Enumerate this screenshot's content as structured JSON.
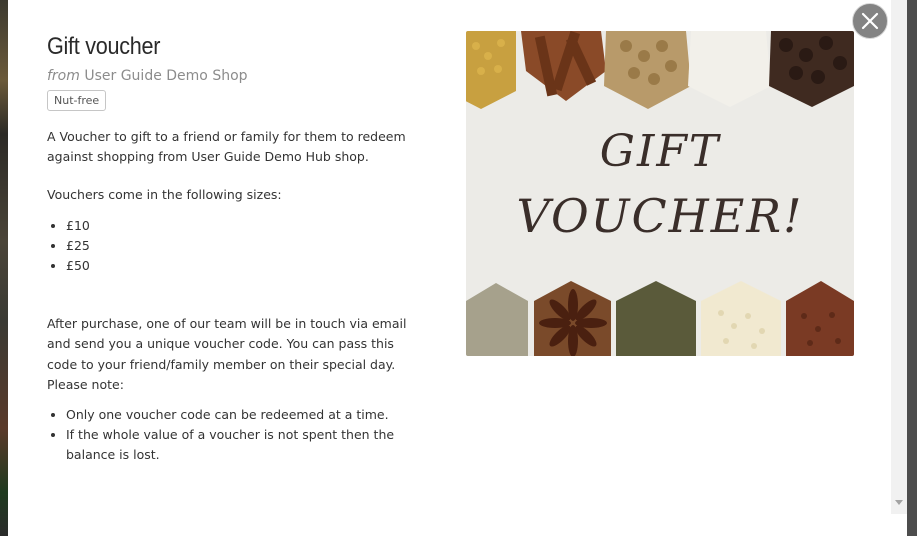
{
  "modal": {
    "title": "Gift voucher",
    "subtitle_from": "from",
    "subtitle_shop": "User Guide Demo Shop",
    "tag": "Nut-free",
    "description": {
      "intro": "A Voucher to gift to a friend or family for them to redeem against shopping from User Guide Demo Hub shop.",
      "sizes_heading": "Vouchers come in the following sizes:",
      "sizes": [
        "£10",
        "£25",
        "£50"
      ],
      "after_purchase": "After purchase, one of our team will be in touch via email and send you a unique voucher code.  You can pass this code to your friend/family member on their special day.",
      "please_note": "Please note:",
      "notes": [
        "Only one voucher code can be redeemed at a time.",
        "If the whole value of a voucher is not spent then the balance is lost."
      ]
    },
    "image": {
      "line1": "GIFT",
      "line2": "VOUCHER!"
    },
    "close_icon": "close-icon"
  },
  "colors": {
    "backdrop": "#5c5c5c",
    "close_button": "#838383",
    "text": "#333333",
    "muted": "#8c8c8c"
  }
}
